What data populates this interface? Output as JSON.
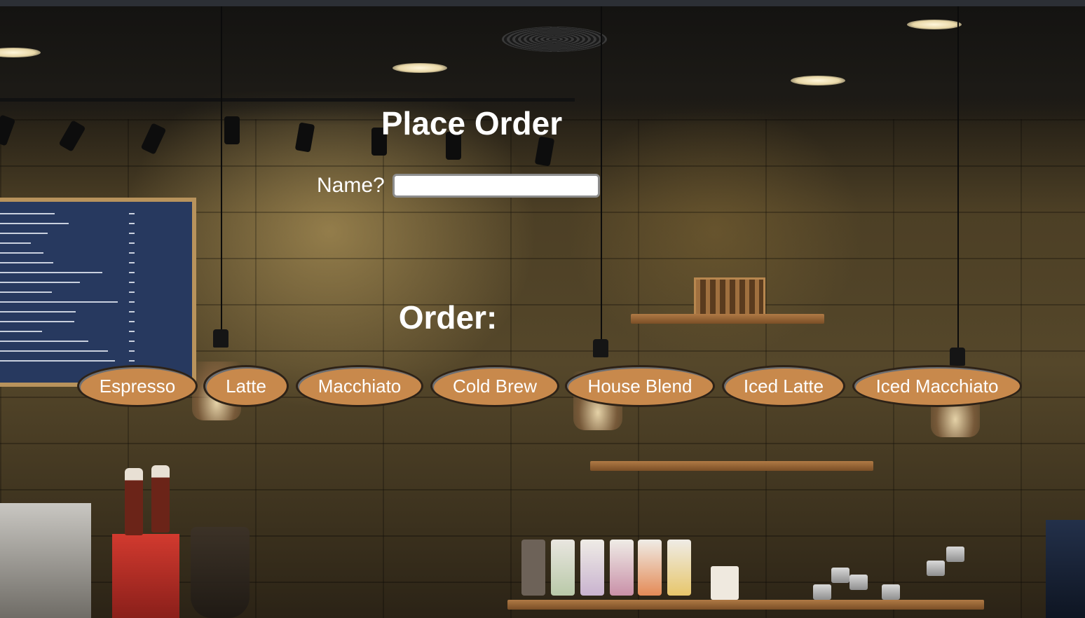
{
  "page": {
    "title": "Place Order"
  },
  "form": {
    "name_label": "Name?",
    "name_value": "",
    "name_placeholder": ""
  },
  "order": {
    "heading": "Order:",
    "buttons": [
      {
        "label": "Espresso"
      },
      {
        "label": "Latte"
      },
      {
        "label": "Macchiato"
      },
      {
        "label": "Cold Brew"
      },
      {
        "label": "House Blend"
      },
      {
        "label": "Iced Latte"
      },
      {
        "label": "Iced Macchiato"
      }
    ]
  },
  "colors": {
    "button_fill": "#c8894c",
    "text": "#ffffff"
  }
}
